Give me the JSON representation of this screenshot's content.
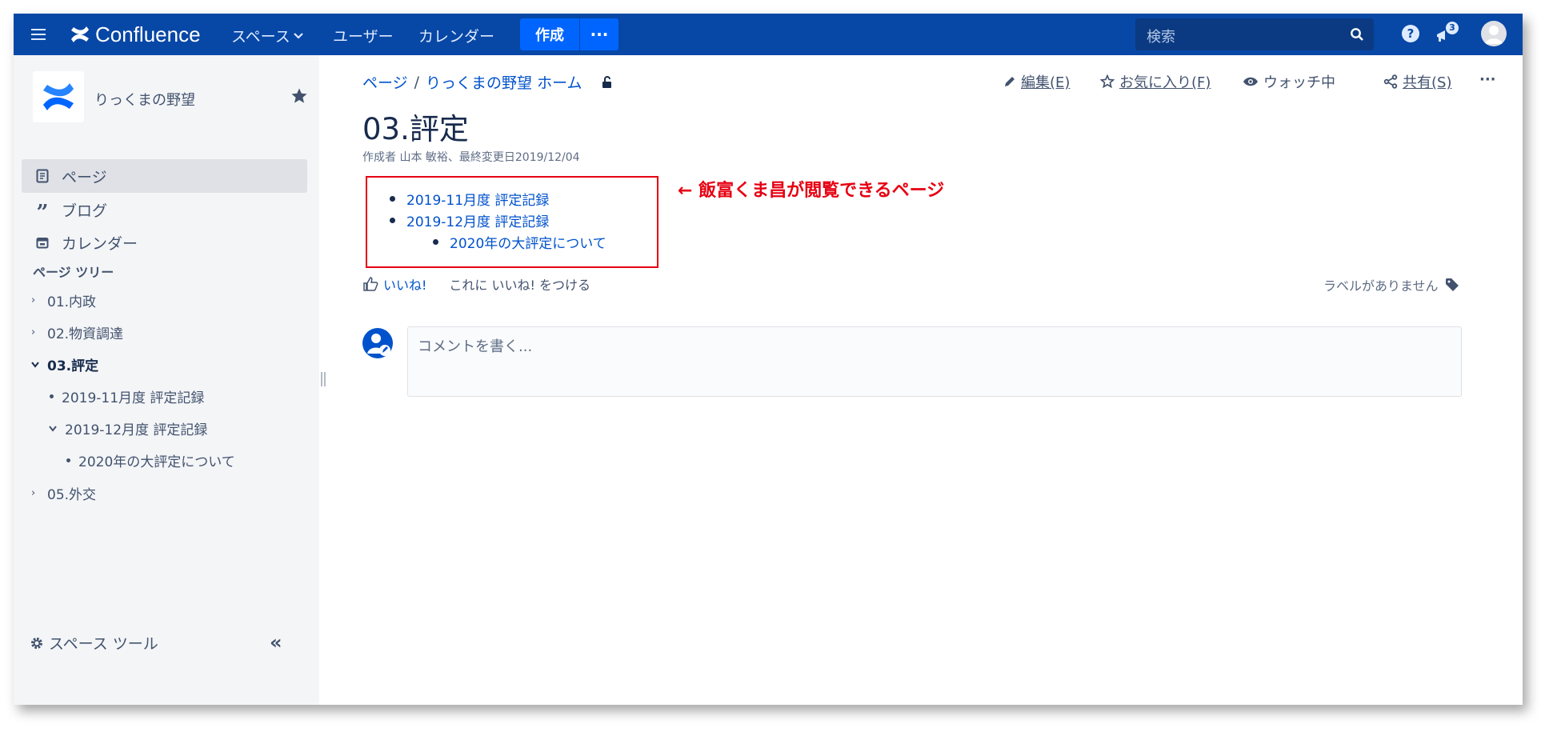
{
  "nav": {
    "product": "Confluence",
    "spaces": "スペース",
    "users": "ユーザー",
    "calendar": "カレンダー",
    "create": "作成",
    "more": "···",
    "search_placeholder": "検索",
    "help": "?",
    "notification_count": "3",
    "brand_color": "#0747A6",
    "accent_color": "#0065FF"
  },
  "sidebar": {
    "space_name": "りっくまの野望",
    "items": [
      {
        "label": "ページ",
        "icon": "page-icon",
        "active": true
      },
      {
        "label": "ブログ",
        "icon": "quote-icon",
        "active": false
      },
      {
        "label": "カレンダー",
        "icon": "calendar-icon",
        "active": false
      }
    ],
    "tree_title": "ページ ツリー",
    "tree": [
      {
        "label": "01.内政",
        "state": "collapsed"
      },
      {
        "label": "02.物資調達",
        "state": "collapsed"
      },
      {
        "label": "03.評定",
        "state": "expanded",
        "current": true
      },
      {
        "label": "2019-11月度 評定記録",
        "state": "leaf"
      },
      {
        "label": "2019-12月度 評定記録",
        "state": "expanded"
      },
      {
        "label": "2020年の大評定について",
        "state": "leaf"
      },
      {
        "label": "05.外交",
        "state": "collapsed"
      }
    ],
    "space_tools": "スペース ツール",
    "collapse": "«"
  },
  "page": {
    "breadcrumb": [
      "ページ",
      "りっくまの野望 ホーム"
    ],
    "breadcrumb_sep": "/",
    "actions": {
      "edit": "編集(E)",
      "favorite": "お気に入り(F)",
      "watch": "ウォッチ中",
      "share": "共有(S)",
      "more": "···"
    },
    "title": "03.評定",
    "byline": "作成者 山本 敏裕、最終変更日2019/12/04",
    "children": [
      "2019-11月度 評定記録",
      "2019-12月度 評定記録",
      "2020年の大評定について"
    ],
    "annotation": "← 飯富くま昌が閲覧できるページ",
    "annotation_color": "#E60012",
    "like": "いいね!",
    "like_cta": "これに いいね! をつける",
    "labels": "ラベルがありません",
    "comment_placeholder": "コメントを書く..."
  }
}
